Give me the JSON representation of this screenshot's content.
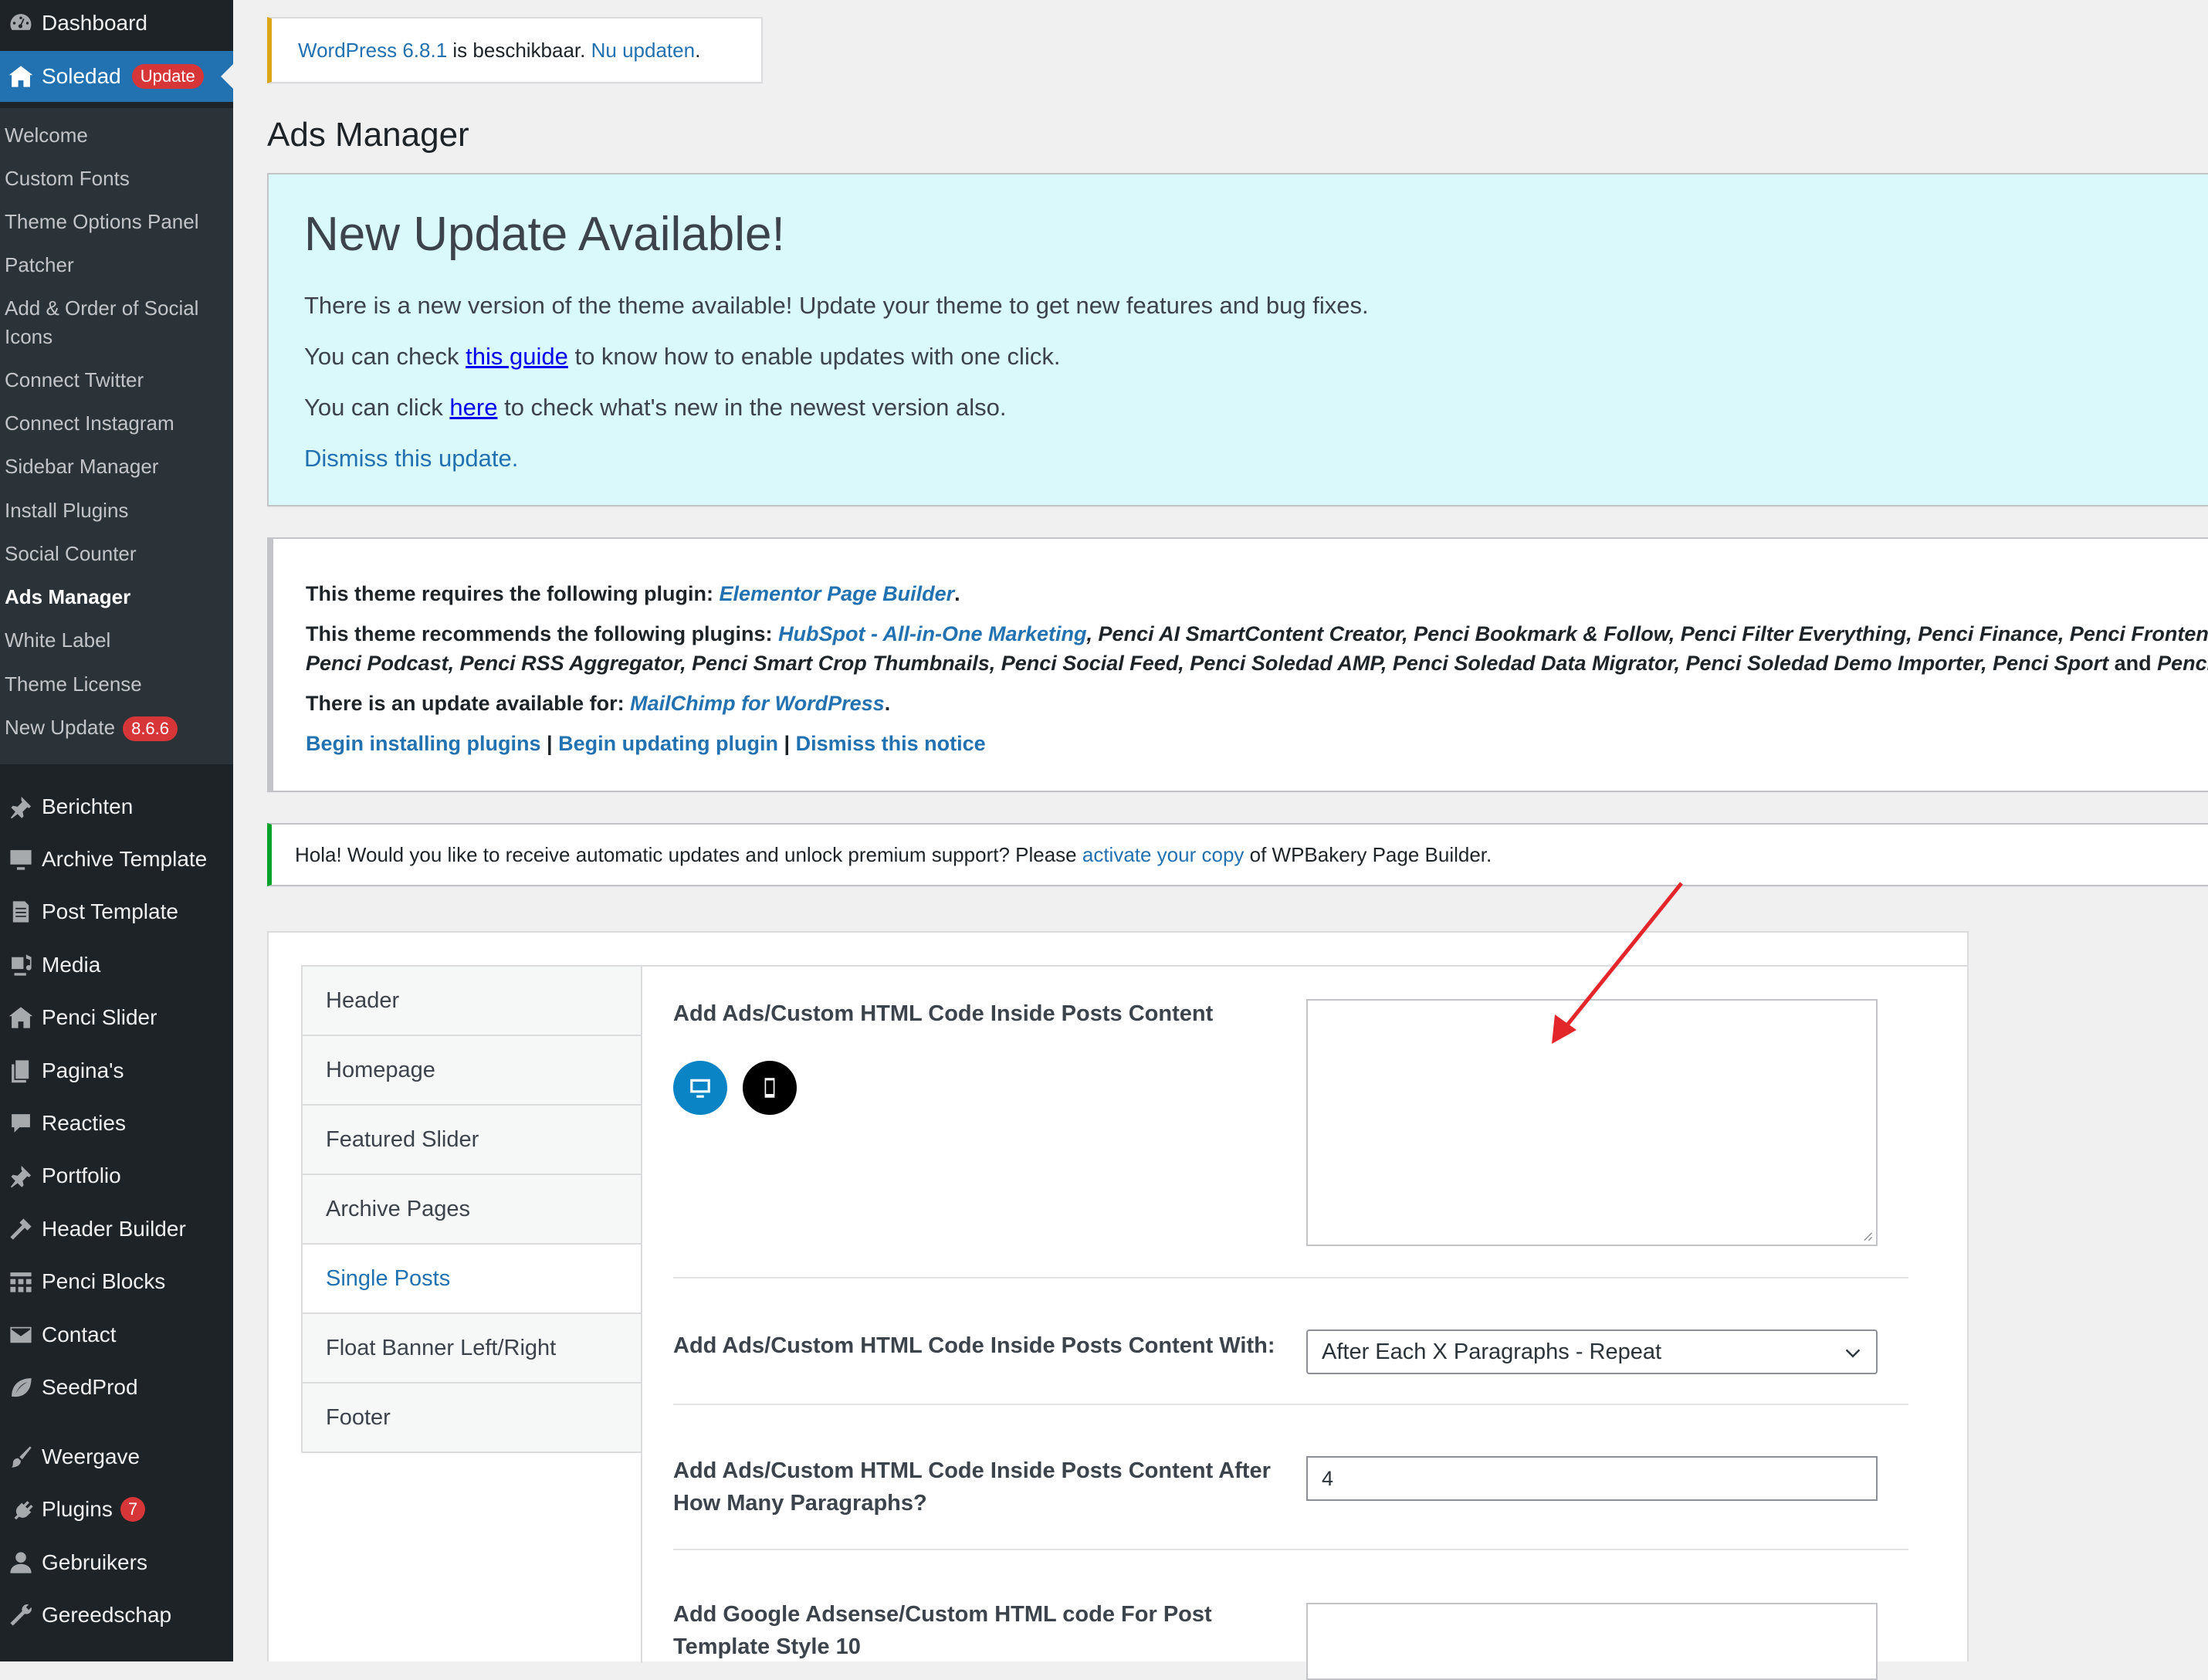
{
  "sidebar": {
    "top": [
      {
        "label": "Dashboard",
        "icon": "dashboard-icon"
      },
      {
        "label": "Soledad",
        "icon": "home-icon",
        "badge": "Update"
      }
    ],
    "submenu": [
      "Welcome",
      "Custom Fonts",
      "Theme Options Panel",
      "Patcher",
      "Add & Order of Social Icons",
      "Connect Twitter",
      "Connect Instagram",
      "Sidebar Manager",
      "Install Plugins",
      "Social Counter",
      "Ads Manager",
      "White Label",
      "Theme License",
      "New Update"
    ],
    "submenu_badge": "8.6.6",
    "items": [
      {
        "label": "Berichten",
        "icon": "pin-icon"
      },
      {
        "label": "Archive Template",
        "icon": "monitor-icon"
      },
      {
        "label": "Post Template",
        "icon": "document-icon"
      },
      {
        "label": "Media",
        "icon": "media-icon"
      },
      {
        "label": "Penci Slider",
        "icon": "home-icon"
      },
      {
        "label": "Pagina's",
        "icon": "pages-icon"
      },
      {
        "label": "Reacties",
        "icon": "comment-icon"
      },
      {
        "label": "Portfolio",
        "icon": "pin-icon"
      },
      {
        "label": "Header Builder",
        "icon": "hammer-icon"
      },
      {
        "label": "Penci Blocks",
        "icon": "grid-icon"
      },
      {
        "label": "Contact",
        "icon": "mail-icon"
      },
      {
        "label": "SeedProd",
        "icon": "leaf-icon"
      },
      {
        "label": "Weergave",
        "icon": "brush-icon"
      },
      {
        "label": "Plugins",
        "icon": "plug-icon",
        "badge": "7"
      },
      {
        "label": "Gebruikers",
        "icon": "user-icon"
      },
      {
        "label": "Gereedschap",
        "icon": "wrench-icon"
      }
    ]
  },
  "wp_update": {
    "version_link": "WordPress 6.8.1",
    "text": " is beschikbaar. ",
    "update_link": "Nu updaten",
    "period": "."
  },
  "page_title": "Ads Manager",
  "theme_update": {
    "title": "New Update Available!",
    "line1": "There is a new version of the theme available! Update your theme to get new features and bug fixes.",
    "line2_pre": "You can check ",
    "line2_link": "this guide",
    "line2_post": " to know how to enable updates with one click.",
    "line3_pre": "You can click ",
    "line3_link": "here",
    "line3_post": " to check what's new in the newest version also.",
    "dismiss": "Dismiss this update."
  },
  "tgmpa": {
    "req_label": "This theme requires the following plugin: ",
    "req_plugin": "Elementor Page Builder",
    "rec_label": "This theme recommends the following plugins: ",
    "rec_link": "HubSpot - All-in-One Marketing",
    "rec_line1_rest": ", Penci AI SmartContent Creator, Penci Bookmark & Follow, Penci Filter Everything, Penci Finance, Penci Frontend Su",
    "rec_line2": "Penci Podcast, Penci RSS Aggregator, Penci Smart Crop Thumbnails, Penci Social Feed, Penci Soledad AMP, Penci Soledad Data Migrator, Penci Soledad Demo Importer, Penci Sport",
    "rec_line2_and": " and ",
    "rec_line2_end": "Penci Tex",
    "upd_label": "There is an update available for: ",
    "upd_plugin": "MailChimp for WordPress",
    "link_install": "Begin installing plugins",
    "link_update": "Begin updating plugin",
    "link_dismiss": "Dismiss this notice",
    "separator": " | "
  },
  "wpbakery": {
    "pre": "Hola! Would you like to receive automatic updates and unlock premium support? Please ",
    "link": "activate your copy",
    "post": " of WPBakery Page Builder."
  },
  "tabs": [
    "Header",
    "Homepage",
    "Featured Slider",
    "Archive Pages",
    "Single Posts",
    "Float Banner Left/Right",
    "Footer"
  ],
  "active_tab": "Single Posts",
  "fields": {
    "f1_label": "Add Ads/Custom HTML Code Inside Posts Content",
    "f1_value": "",
    "f2_label": "Add Ads/Custom HTML Code Inside Posts Content With:",
    "f2_value": "After Each X Paragraphs - Repeat",
    "f3_label": "Add Ads/Custom HTML Code Inside Posts Content After How Many Paragraphs?",
    "f3_value": "4",
    "f4_label": "Add Google Adsense/Custom HTML code For Post Template Style 10"
  },
  "colors": {
    "accent": "#2271b1",
    "sidebar": "#1d2327",
    "badge": "#d63638",
    "notice_bg": "#d9f9fb",
    "arrow": "#e3262a"
  }
}
